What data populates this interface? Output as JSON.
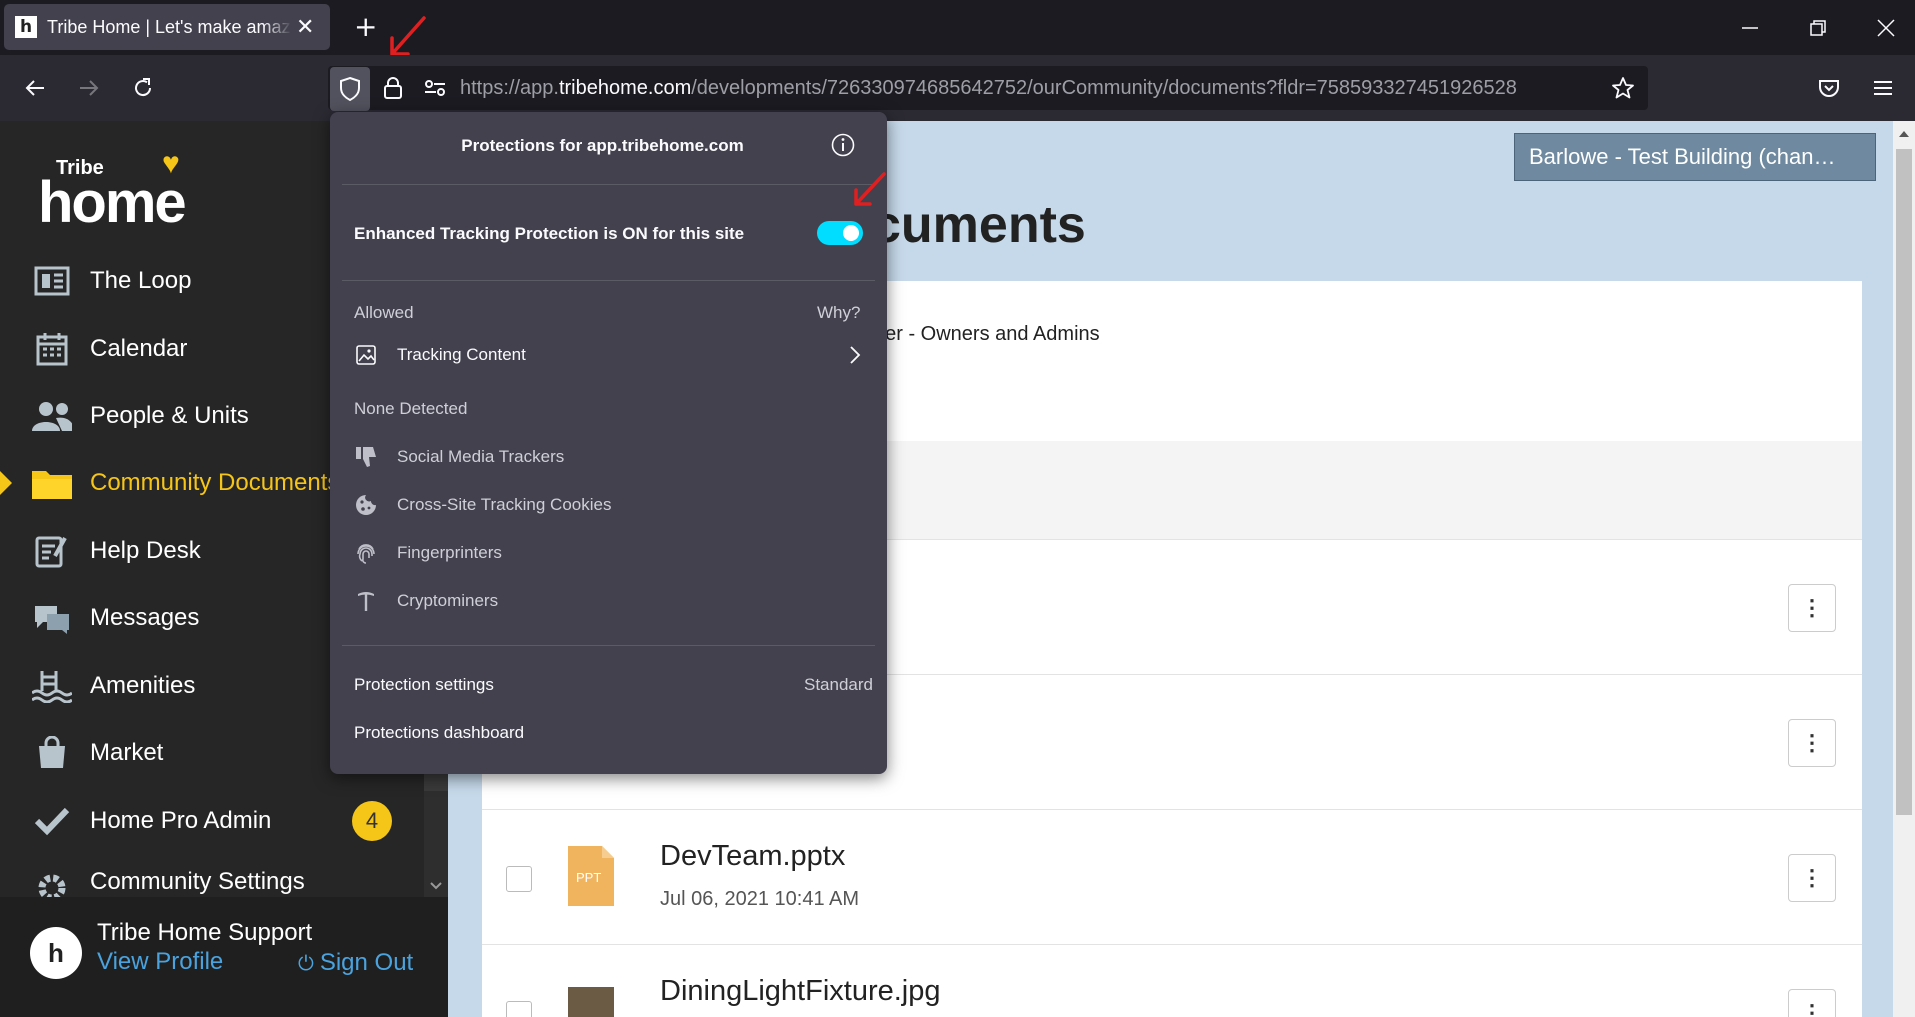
{
  "browser": {
    "tab_title": "Tribe Home | Let's make amazing",
    "tab_close": "✕",
    "new_tab": "+",
    "url_prefix": "https://app.",
    "url_host": "tribehome.com",
    "url_path": "/developments/726330974685642752/ourCommunity/documents?fldr=758593327451926528"
  },
  "sidebar": {
    "logo_small": "Tribe",
    "logo_big": "home",
    "items": [
      {
        "label": "The Loop",
        "icon": "loop-icon"
      },
      {
        "label": "Calendar",
        "icon": "calendar-icon"
      },
      {
        "label": "People & Units",
        "icon": "people-icon"
      },
      {
        "label": "Community Documents",
        "icon": "folder-icon"
      },
      {
        "label": "Help Desk",
        "icon": "help-desk-icon"
      },
      {
        "label": "Messages",
        "icon": "messages-icon"
      },
      {
        "label": "Amenities",
        "icon": "amenities-icon"
      },
      {
        "label": "Market",
        "icon": "market-icon"
      },
      {
        "label": "Home Pro Admin",
        "icon": "checkmark-icon",
        "badge": "4"
      },
      {
        "label": "Community Settings",
        "icon": "gear-icon"
      }
    ],
    "profile": {
      "name": "Tribe Home Support",
      "view_profile": "View Profile",
      "sign_out": "Sign Out"
    }
  },
  "main": {
    "building_button": "Barlowe - Test Building (chan…",
    "heading": "cuments",
    "folder_desc": "der - Owners and Admins",
    "files": [
      {
        "name": "DevTeam.pptx",
        "date": "Jul 06, 2021 10:41 AM",
        "type_label": "PPT"
      },
      {
        "name": "DiningLightFixture.jpg"
      }
    ]
  },
  "popup": {
    "title": "Protections for app.tribehome.com",
    "etp_label": "Enhanced Tracking Protection is ON for this site",
    "etp_on": true,
    "allowed_label": "Allowed",
    "why_label": "Why?",
    "allowed_items": [
      {
        "label": "Tracking Content",
        "icon": "tracking-content-icon"
      }
    ],
    "none_detected_label": "None Detected",
    "none_items": [
      {
        "label": "Social Media Trackers",
        "icon": "thumbs-down-icon"
      },
      {
        "label": "Cross-Site Tracking Cookies",
        "icon": "cookie-icon"
      },
      {
        "label": "Fingerprinters",
        "icon": "fingerprint-icon"
      },
      {
        "label": "Cryptominers",
        "icon": "pickaxe-icon"
      }
    ],
    "protection_settings_label": "Protection settings",
    "protection_level": "Standard",
    "dashboard_label": "Protections dashboard"
  },
  "colors": {
    "accent": "#f5c518",
    "toggle": "#00ddff",
    "annotation": "#e02020"
  }
}
